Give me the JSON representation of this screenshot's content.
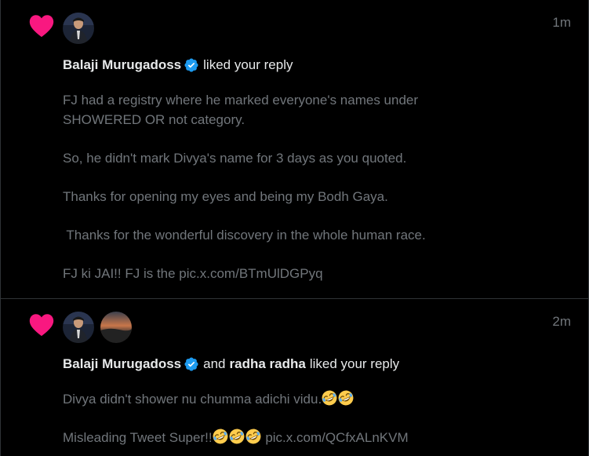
{
  "notifications": [
    {
      "time": "1m",
      "users": [
        {
          "name": "Balaji Murugadoss",
          "verified": true
        }
      ],
      "action": "liked your reply",
      "lines": [
        "FJ had a registry where he marked everyone's names under",
        "SHOWERED OR not category.",
        "So, he didn't mark Divya's name for 3 days as you quoted.",
        "Thanks for opening my eyes and being my Bodh Gaya.",
        " Thanks for the wonderful discovery in the whole human race.",
        "FJ ki JAI!! FJ is the pic.x.com/BTmUlDGPyq"
      ]
    },
    {
      "time": "2m",
      "users": [
        {
          "name": "Balaji Murugadoss",
          "verified": true
        },
        {
          "name": "radha radha",
          "verified": false
        }
      ],
      "conjunction": "and",
      "action": "liked your reply",
      "lines": [
        "Divya didn't shower nu chumma adichi vidu.",
        "Misleading Tweet Super!!",
        "pic.x.com/QCfxALnKVM"
      ],
      "emoji": "rolling-on-floor-laughing-emoji"
    }
  ],
  "colors": {
    "heart": "#f91880",
    "verified": "#1d9bf0",
    "muted_text": "#71767b",
    "primary_text": "#e7e9ea",
    "divider": "#2f3336"
  }
}
